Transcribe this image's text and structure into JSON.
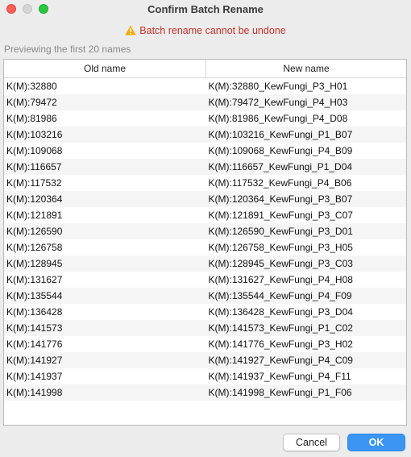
{
  "window": {
    "title": "Confirm Batch Rename"
  },
  "warning": {
    "icon": "warning-triangle-icon",
    "text": "Batch rename cannot be undone",
    "color": "#c4312b"
  },
  "preview_label": "Previewing the first 20 names",
  "table": {
    "headers": [
      "Old name",
      "New name"
    ],
    "rows": [
      [
        "K(M):32880",
        "K(M):32880_KewFungi_P3_H01"
      ],
      [
        "K(M):79472",
        "K(M):79472_KewFungi_P4_H03"
      ],
      [
        "K(M):81986",
        "K(M):81986_KewFungi_P4_D08"
      ],
      [
        "K(M):103216",
        "K(M):103216_KewFungi_P1_B07"
      ],
      [
        "K(M):109068",
        "K(M):109068_KewFungi_P4_B09"
      ],
      [
        "K(M):116657",
        "K(M):116657_KewFungi_P1_D04"
      ],
      [
        "K(M):117532",
        "K(M):117532_KewFungi_P4_B06"
      ],
      [
        "K(M):120364",
        "K(M):120364_KewFungi_P3_B07"
      ],
      [
        "K(M):121891",
        "K(M):121891_KewFungi_P3_C07"
      ],
      [
        "K(M):126590",
        "K(M):126590_KewFungi_P3_D01"
      ],
      [
        "K(M):126758",
        "K(M):126758_KewFungi_P3_H05"
      ],
      [
        "K(M):128945",
        "K(M):128945_KewFungi_P3_C03"
      ],
      [
        "K(M):131627",
        "K(M):131627_KewFungi_P4_H08"
      ],
      [
        "K(M):135544",
        "K(M):135544_KewFungi_P4_F09"
      ],
      [
        "K(M):136428",
        "K(M):136428_KewFungi_P3_D04"
      ],
      [
        "K(M):141573",
        "K(M):141573_KewFungi_P1_C02"
      ],
      [
        "K(M):141776",
        "K(M):141776_KewFungi_P3_H02"
      ],
      [
        "K(M):141927",
        "K(M):141927_KewFungi_P4_C09"
      ],
      [
        "K(M):141937",
        "K(M):141937_KewFungi_P4_F11"
      ],
      [
        "K(M):141998",
        "K(M):141998_KewFungi_P1_F06"
      ]
    ]
  },
  "buttons": {
    "cancel": "Cancel",
    "ok": "OK"
  },
  "colors": {
    "accent": "#3b96f3",
    "close": "#fe5f57",
    "maximize": "#28c840"
  }
}
